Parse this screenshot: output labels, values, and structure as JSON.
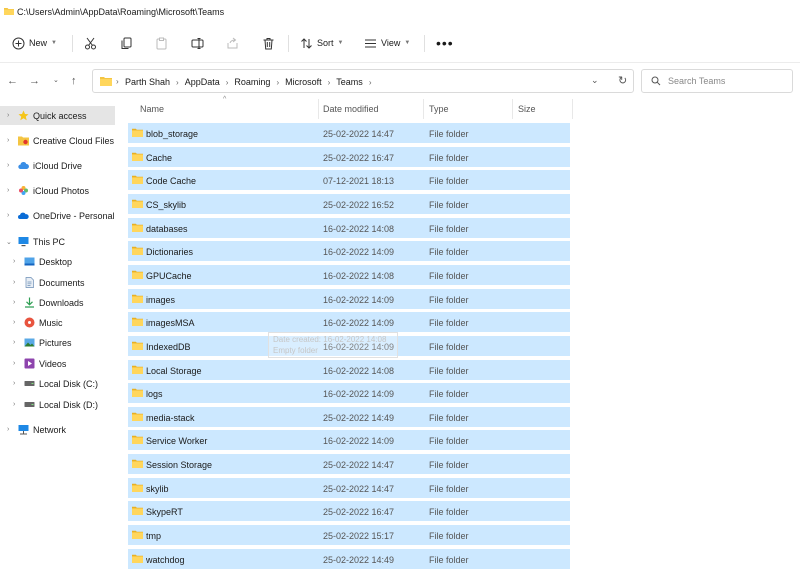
{
  "window": {
    "title": "C:\\Users\\Admin\\AppData\\Roaming\\Microsoft\\Teams"
  },
  "toolbar": {
    "new_label": "New",
    "sort_label": "Sort",
    "view_label": "View"
  },
  "address": {
    "crumbs": [
      "Parth Shah",
      "AppData",
      "Roaming",
      "Microsoft",
      "Teams"
    ],
    "search_placeholder": "Search Teams"
  },
  "sidebar": {
    "items": [
      {
        "label": "Quick access"
      },
      {
        "label": "Creative Cloud Files"
      },
      {
        "label": "iCloud Drive"
      },
      {
        "label": "iCloud Photos"
      },
      {
        "label": "OneDrive - Personal"
      },
      {
        "label": "This PC"
      },
      {
        "label": "Desktop"
      },
      {
        "label": "Documents"
      },
      {
        "label": "Downloads"
      },
      {
        "label": "Music"
      },
      {
        "label": "Pictures"
      },
      {
        "label": "Videos"
      },
      {
        "label": "Local Disk (C:)"
      },
      {
        "label": "Local Disk (D:)"
      },
      {
        "label": "Network"
      }
    ]
  },
  "columns": {
    "name": "Name",
    "date": "Date modified",
    "type": "Type",
    "size": "Size"
  },
  "files": [
    {
      "name": "blob_storage",
      "date": "25-02-2022 14:47",
      "type": "File folder"
    },
    {
      "name": "Cache",
      "date": "25-02-2022 16:47",
      "type": "File folder"
    },
    {
      "name": "Code Cache",
      "date": "07-12-2021 18:13",
      "type": "File folder"
    },
    {
      "name": "CS_skylib",
      "date": "25-02-2022 16:52",
      "type": "File folder"
    },
    {
      "name": "databases",
      "date": "16-02-2022 14:08",
      "type": "File folder"
    },
    {
      "name": "Dictionaries",
      "date": "16-02-2022 14:09",
      "type": "File folder"
    },
    {
      "name": "GPUCache",
      "date": "16-02-2022 14:08",
      "type": "File folder"
    },
    {
      "name": "images",
      "date": "16-02-2022 14:09",
      "type": "File folder"
    },
    {
      "name": "imagesMSA",
      "date": "16-02-2022 14:09",
      "type": "File folder"
    },
    {
      "name": "IndexedDB",
      "date": "16-02-2022 14:09",
      "type": "File folder"
    },
    {
      "name": "Local Storage",
      "date": "16-02-2022 14:08",
      "type": "File folder"
    },
    {
      "name": "logs",
      "date": "16-02-2022 14:09",
      "type": "File folder"
    },
    {
      "name": "media-stack",
      "date": "25-02-2022 14:49",
      "type": "File folder"
    },
    {
      "name": "Service Worker",
      "date": "16-02-2022 14:09",
      "type": "File folder"
    },
    {
      "name": "Session Storage",
      "date": "25-02-2022 14:47",
      "type": "File folder"
    },
    {
      "name": "skylib",
      "date": "25-02-2022 14:47",
      "type": "File folder"
    },
    {
      "name": "SkypeRT",
      "date": "25-02-2022 16:47",
      "type": "File folder"
    },
    {
      "name": "tmp",
      "date": "25-02-2022 15:17",
      "type": "File folder"
    },
    {
      "name": "watchdog",
      "date": "25-02-2022 14:49",
      "type": "File folder"
    }
  ],
  "tooltip": {
    "line1": "Date created: 16-02-2022 14:08",
    "line2": "Empty folder"
  },
  "colors": {
    "selection": "#cce8ff",
    "folder": "#f4c542",
    "accent": "#0a6cd6"
  }
}
